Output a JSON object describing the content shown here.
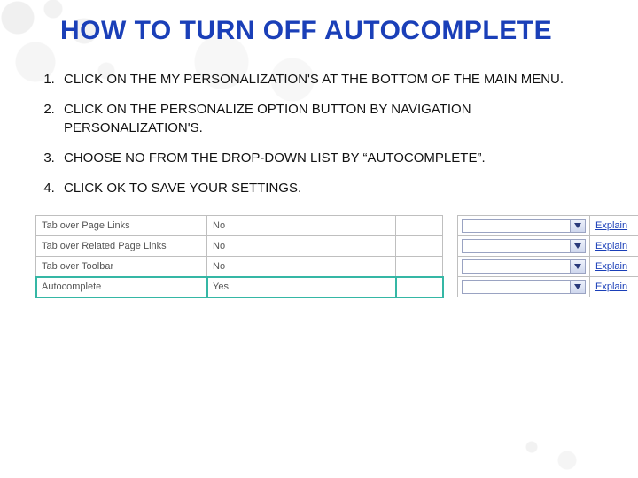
{
  "title": "HOW TO TURN OFF AUTOCOMPLETE",
  "steps": [
    "CLICK ON THE MY PERSONALIZATION'S AT THE BOTTOM OF THE MAIN MENU.",
    "CLICK ON THE PERSONALIZE OPTION BUTTON BY NAVIGATION PERSONALIZATION'S.",
    "CHOOSE NO FROM THE DROP-DOWN LIST BY “AUTOCOMPLETE”.",
    "CLICK OK TO SAVE YOUR SETTINGS."
  ],
  "explain_label": "Explain",
  "settings_rows": [
    {
      "label": "Tab over Page Links",
      "value": "No",
      "highlight": false
    },
    {
      "label": "Tab over Related Page Links",
      "value": "No",
      "highlight": false
    },
    {
      "label": "Tab over Toolbar",
      "value": "No",
      "highlight": false
    },
    {
      "label": "Autocomplete",
      "value": "Yes",
      "highlight": true
    }
  ],
  "colors": {
    "title": "#1a3fb8",
    "highlight_border": "#35b7a5"
  }
}
